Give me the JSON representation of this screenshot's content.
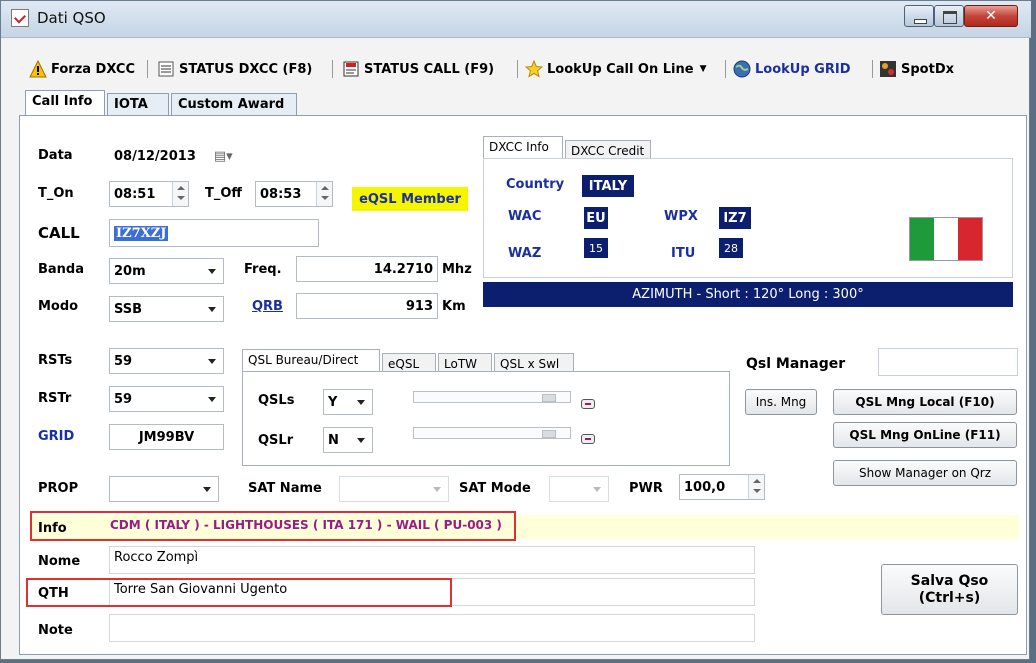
{
  "window": {
    "title": "Dati QSO"
  },
  "toolbar": {
    "forza_dxcc": "Forza DXCC",
    "status_dxcc": "STATUS DXCC (F8)",
    "status_call": "STATUS CALL (F9)",
    "lookup_call": "LookUp Call On Line",
    "lookup_grid": "LookUp GRID",
    "spotdx": "SpotDx"
  },
  "tabs": [
    "Call Info",
    "IOTA",
    "Custom Award"
  ],
  "form": {
    "data_label": "Data",
    "data_value": "08/12/2013",
    "t_on_label": "T_On",
    "t_on_value": "08:51",
    "t_off_label": "T_Off",
    "t_off_value": "08:53",
    "eqsl_member": "eQSL Member",
    "call_label": "CALL",
    "call_value": "IZ7XZJ",
    "banda_label": "Banda",
    "banda_value": "20m",
    "freq_label": "Freq.",
    "freq_value": "14.2710",
    "freq_unit": "Mhz",
    "modo_label": "Modo",
    "modo_value": "SSB",
    "qrb_label": "QRB",
    "qrb_value": "913",
    "qrb_unit": "Km",
    "rsts_label": "RSTs",
    "rsts_value": "59",
    "rstr_label": "RSTr",
    "rstr_value": "59",
    "grid_label": "GRID",
    "grid_value": "JM99BV",
    "prop_label": "PROP",
    "prop_value": "",
    "sat_name_label": "SAT Name",
    "sat_mode_label": "SAT Mode",
    "pwr_label": "PWR",
    "pwr_value": "100,0",
    "info_label": "Info",
    "info_value": "CDM ( ITALY )  - LIGHTHOUSES ( ITA 171 )  - WAIL ( PU-003 )",
    "nome_label": "Nome",
    "nome_value": "Rocco Zompì",
    "qth_label": "QTH",
    "qth_value": "Torre San Giovanni Ugento",
    "note_label": "Note",
    "note_value": ""
  },
  "dxcc": {
    "tabs": [
      "DXCC Info",
      "DXCC Credit"
    ],
    "country_label": "Country",
    "country_value": "ITALY",
    "wac_label": "WAC",
    "wac_value": "EU",
    "wpx_label": "WPX",
    "wpx_value": "IZ7",
    "waz_label": "WAZ",
    "waz_value": "15",
    "itu_label": "ITU",
    "itu_value": "28",
    "azimuth": "AZIMUTH - Short : 120° Long : 300°"
  },
  "qsl": {
    "tabs": [
      "QSL Bureau/Direct",
      "eQSL",
      "LoTW",
      "QSL x Swl"
    ],
    "qsls_label": "QSLs",
    "qsls_value": "Y",
    "qslr_label": "QSLr",
    "qslr_value": "N",
    "manager_label": "Qsl Manager",
    "manager_value": "",
    "ins_mng": "Ins. Mng",
    "mng_local": "QSL Mng Local (F10)",
    "mng_online": "QSL Mng OnLine (F11)",
    "show_manager": "Show Manager on Qrz"
  },
  "save_button": {
    "line1": "Salva Qso",
    "line2": "(Ctrl+s)"
  },
  "colors": {
    "navy": "#0c1f6e",
    "eqsl_bg": "#f5f500",
    "info_text": "#9a1a8a",
    "link_blue": "#1a2fa0",
    "highlight_red": "#e03030"
  }
}
